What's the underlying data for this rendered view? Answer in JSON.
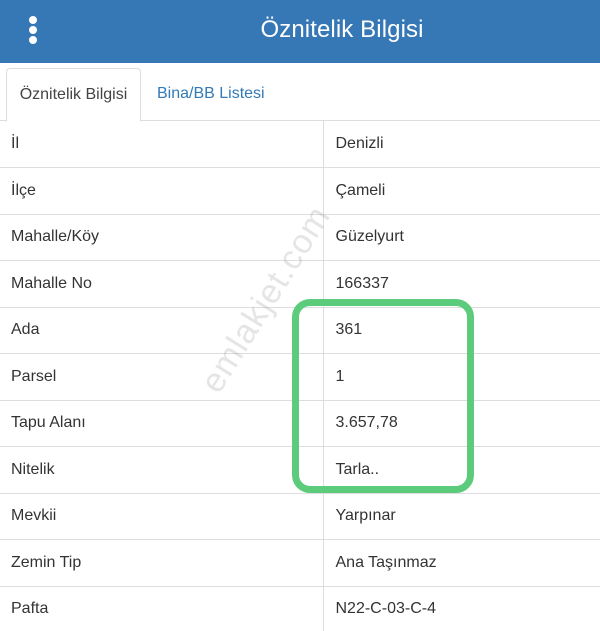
{
  "header": {
    "title": "Öznitelik Bilgisi",
    "menu_icon": "vertical-ellipsis-icon"
  },
  "tabs": [
    {
      "label": "Öznitelik Bilgisi",
      "active": true
    },
    {
      "label": "Bina/BB Listesi",
      "active": false
    }
  ],
  "rows": [
    {
      "key": "İl",
      "value": "Denizli"
    },
    {
      "key": "İlçe",
      "value": "Çameli"
    },
    {
      "key": "Mahalle/Köy",
      "value": "Güzelyurt"
    },
    {
      "key": "Mahalle No",
      "value": "166337"
    },
    {
      "key": "Ada",
      "value": "361"
    },
    {
      "key": "Parsel",
      "value": "1"
    },
    {
      "key": "Tapu Alanı",
      "value": "3.657,78"
    },
    {
      "key": "Nitelik",
      "value": "Tarla.."
    },
    {
      "key": "Mevkii",
      "value": "Yarpınar"
    },
    {
      "key": "Zemin Tip",
      "value": "Ana Taşınmaz"
    },
    {
      "key": "Pafta",
      "value": "N22-C-03-C-4"
    }
  ],
  "watermark": "emlakjet.com",
  "colors": {
    "header_bg": "#3677b5",
    "link": "#337ab7",
    "highlight": "#5ccb7b"
  }
}
